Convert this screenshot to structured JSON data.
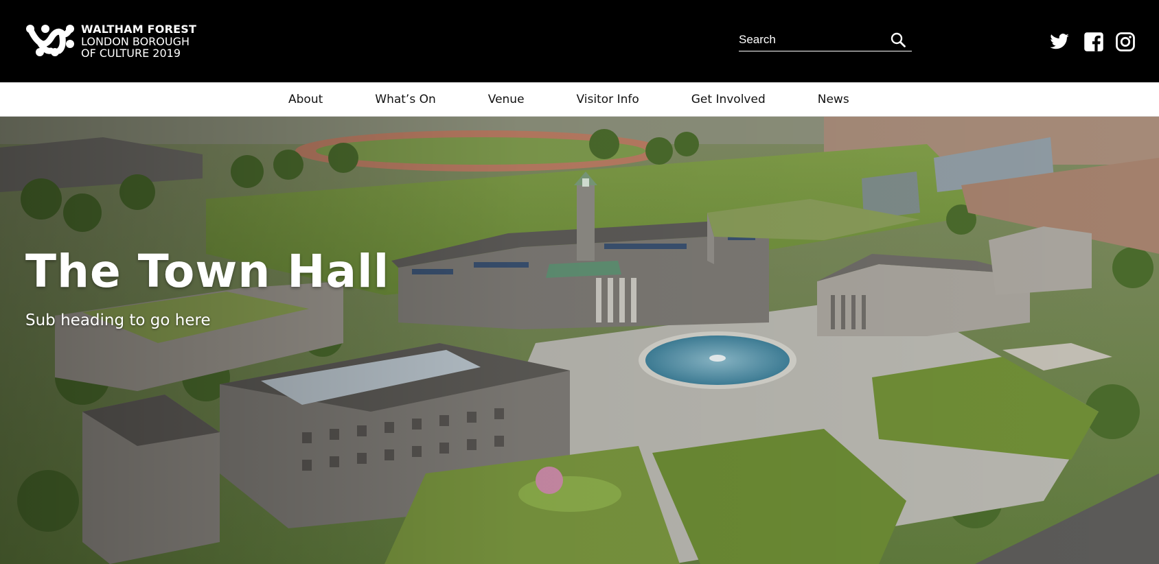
{
  "header": {
    "logo": {
      "line1": "WALTHAM FOREST",
      "line2": "LONDON BOROUGH",
      "line3": "OF CULTURE 2019"
    },
    "search": {
      "placeholder": "Search",
      "icon": "search-icon"
    },
    "social": [
      {
        "name": "twitter",
        "icon": "twitter-icon"
      },
      {
        "name": "facebook",
        "icon": "facebook-icon"
      },
      {
        "name": "instagram",
        "icon": "instagram-icon"
      }
    ]
  },
  "nav": {
    "items": [
      "About",
      "What’s On",
      "Venue",
      "Visitor Info",
      "Get Involved",
      "News"
    ]
  },
  "hero": {
    "title": "The Town Hall",
    "subtitle": "Sub heading to go here",
    "image_subject": "aerial-town-hall-rendering"
  },
  "colors": {
    "header_bg": "#000000",
    "nav_bg": "#ffffff",
    "text_light": "#ffffff",
    "text_dark": "#111111"
  }
}
